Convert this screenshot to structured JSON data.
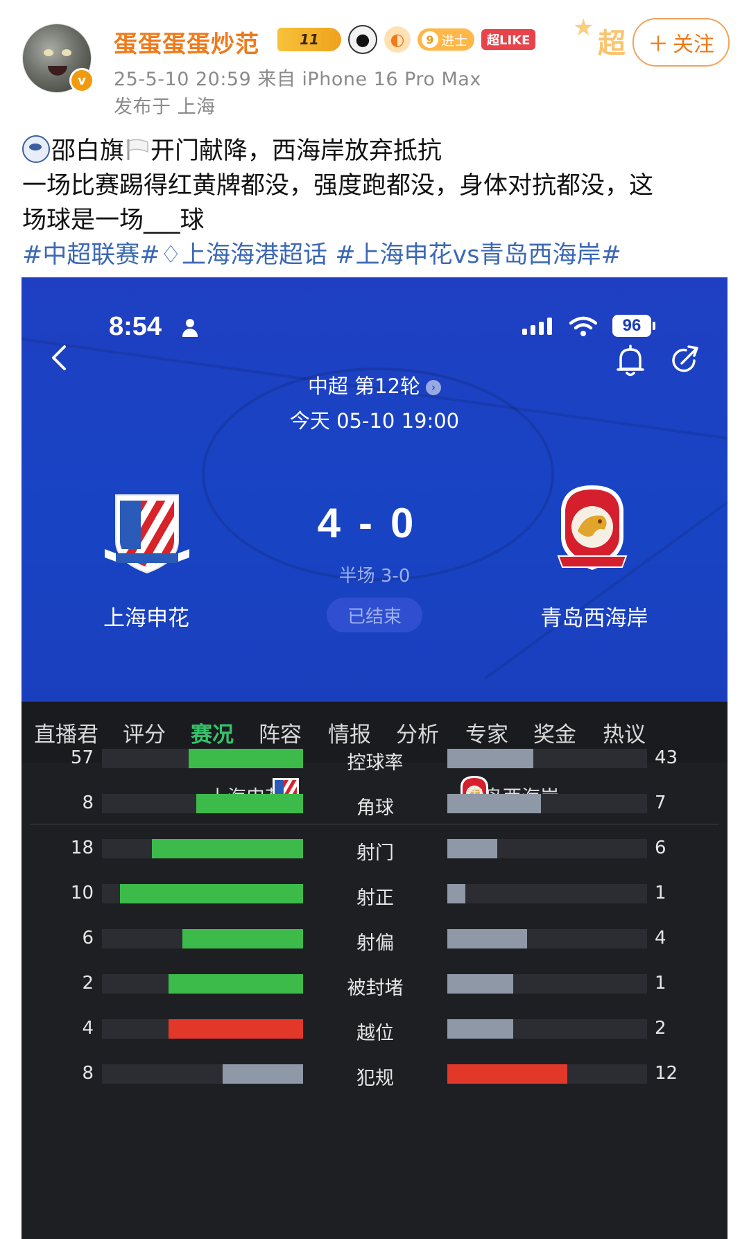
{
  "post": {
    "username": "蛋蛋蛋蛋炒范",
    "level_badge": "11",
    "rank_num": "9",
    "rank_text": "进士",
    "superlike": "超LIKE",
    "chao_deco": "超",
    "follow": "关注",
    "time_source": "25-5-10 20:59  来自 iPhone 16 Pro Max",
    "location": "发布于 上海",
    "verified_badge": "v",
    "line1": "邵白旗",
    "line1b": "开门献降，西海岸放弃抵抗",
    "line2": "一场比赛踢得红黄牌都没，强度跑都没，身体对抗都没，这",
    "line3": "场球是一场___球",
    "tags": [
      "#中超联赛#",
      "上海海港超话",
      "#上海申花vs青岛西海岸#"
    ]
  },
  "phone": {
    "time": "8:54",
    "battery": "96",
    "league": "中超 第12轮",
    "date": "今天 05-10 19:00",
    "score_home": "4",
    "score_sep": "-",
    "score_away": "0",
    "half": "半场 3-0",
    "status": "已结束",
    "home_team": "上海申花",
    "away_team": "青岛西海岸"
  },
  "tabs": [
    "直播君",
    "评分",
    "赛况",
    "阵容",
    "情报",
    "分析",
    "专家",
    "奖金",
    "热议"
  ],
  "active_tab": "赛况",
  "stats_header": {
    "home": "上海申花",
    "away": "青岛西海岸"
  },
  "colors": {
    "home_bar": "#3dbb4a",
    "home_bar_red": "#e1382a",
    "home_bar_grey": "#8f98a6",
    "away_bar": "#8f98a6",
    "away_bar_red": "#e1382a",
    "accent_green": "#35c26b"
  },
  "stats": [
    {
      "label": "控球率",
      "home": "57",
      "away": "43",
      "home_frac": 0.57,
      "away_frac": 0.43,
      "home_color": "green",
      "away_color": "grey"
    },
    {
      "label": "角球",
      "home": "8",
      "away": "7",
      "home_frac": 0.53,
      "away_frac": 0.47,
      "home_color": "green",
      "away_color": "grey"
    },
    {
      "label": "射门",
      "home": "18",
      "away": "6",
      "home_frac": 0.75,
      "away_frac": 0.25,
      "home_color": "green",
      "away_color": "grey"
    },
    {
      "label": "射正",
      "home": "10",
      "away": "1",
      "home_frac": 0.91,
      "away_frac": 0.09,
      "home_color": "green",
      "away_color": "grey"
    },
    {
      "label": "射偏",
      "home": "6",
      "away": "4",
      "home_frac": 0.6,
      "away_frac": 0.4,
      "home_color": "green",
      "away_color": "grey"
    },
    {
      "label": "被封堵",
      "home": "2",
      "away": "1",
      "home_frac": 0.67,
      "away_frac": 0.33,
      "home_color": "green",
      "away_color": "grey"
    },
    {
      "label": "越位",
      "home": "4",
      "away": "2",
      "home_frac": 0.67,
      "away_frac": 0.33,
      "home_color": "red",
      "away_color": "grey"
    },
    {
      "label": "犯规",
      "home": "8",
      "away": "12",
      "home_frac": 0.4,
      "away_frac": 0.6,
      "home_color": "grey",
      "away_color": "red"
    }
  ]
}
